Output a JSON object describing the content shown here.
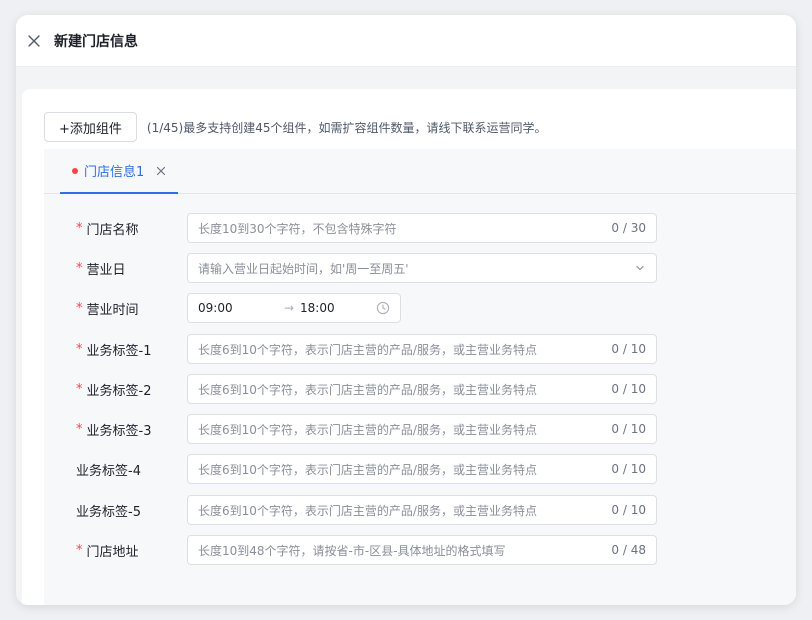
{
  "dialog": {
    "title": "新建门店信息"
  },
  "toolbar": {
    "add_label": "+添加组件",
    "hint": "(1/45)最多支持创建45个组件，如需扩容组件数量，请线下联系运营同学。"
  },
  "tabs": [
    {
      "label": "门店信息1",
      "active": true,
      "has_error": true
    }
  ],
  "form": {
    "store_name": {
      "label": "门店名称",
      "required": true,
      "placeholder": "长度10到30个字符，不包含特殊字符",
      "counter": "0 / 30"
    },
    "business_days": {
      "label": "营业日",
      "required": true,
      "placeholder": "请输入营业日起始时间，如'周一至周五'"
    },
    "business_hours": {
      "label": "营业时间",
      "required": true,
      "start": "09:00",
      "separator": "→",
      "end": "18:00"
    },
    "tag1": {
      "label": "业务标签-1",
      "required": true,
      "placeholder": "长度6到10个字符，表示门店主营的产品/服务，或主营业务特点",
      "counter": "0 / 10"
    },
    "tag2": {
      "label": "业务标签-2",
      "required": true,
      "placeholder": "长度6到10个字符，表示门店主营的产品/服务，或主营业务特点",
      "counter": "0 / 10"
    },
    "tag3": {
      "label": "业务标签-3",
      "required": true,
      "placeholder": "长度6到10个字符，表示门店主营的产品/服务，或主营业务特点",
      "counter": "0 / 10"
    },
    "tag4": {
      "label": "业务标签-4",
      "required": false,
      "placeholder": "长度6到10个字符，表示门店主营的产品/服务，或主营业务特点",
      "counter": "0 / 10"
    },
    "tag5": {
      "label": "业务标签-5",
      "required": false,
      "placeholder": "长度6到10个字符，表示门店主营的产品/服务，或主营业务特点",
      "counter": "0 / 10"
    },
    "address": {
      "label": "门店地址",
      "required": true,
      "placeholder": "长度10到48个字符，请按省-市-区县-具体地址的格式填写",
      "counter": "0 / 48"
    },
    "required_mark": "*"
  },
  "colors": {
    "accent": "#2f6ee8",
    "required": "#f5454a"
  },
  "icons": {
    "close": "close-icon",
    "tab_close": "close-icon",
    "select": "chevron-down-icon",
    "time": "clock-icon"
  }
}
